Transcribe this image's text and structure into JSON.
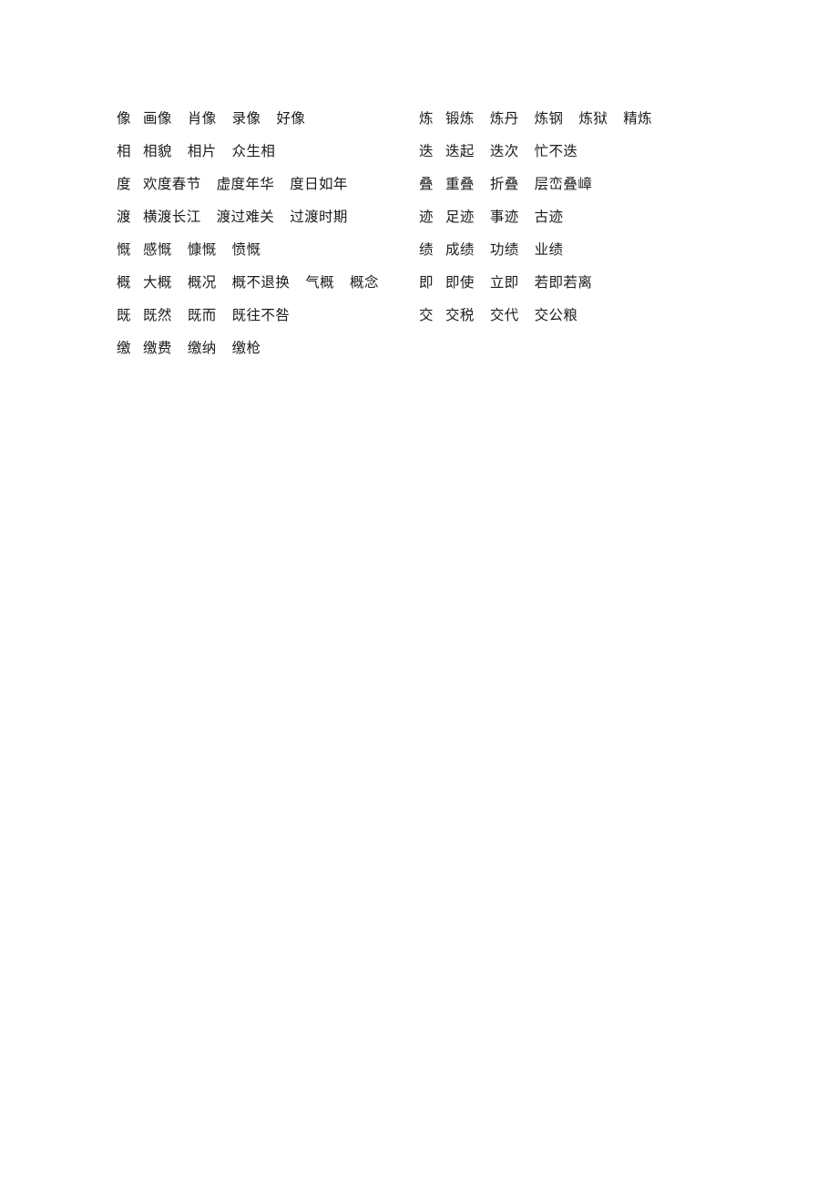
{
  "document": {
    "page_background": "#ffffff",
    "text_color": "#1c1c1c",
    "columns": [
      {
        "id": "left",
        "rows": [
          {
            "headword": "像",
            "terms": [
              "画像",
              "肖像",
              "录像",
              "好像"
            ]
          },
          {
            "headword": "相",
            "terms": [
              "相貌",
              "相片",
              "众生相"
            ]
          },
          {
            "headword": "度",
            "terms": [
              "欢度春节",
              "虚度年华",
              "度日如年"
            ]
          },
          {
            "headword": "渡",
            "terms": [
              "横渡长江",
              "渡过难关",
              "过渡时期"
            ]
          },
          {
            "headword": "慨",
            "terms": [
              "感慨",
              "慷慨",
              "愤慨"
            ]
          },
          {
            "headword": "概",
            "terms": [
              "大概",
              "概况",
              "概不退换",
              "气概",
              "概念"
            ]
          },
          {
            "headword": "既",
            "terms": [
              "既然",
              "既而",
              "既往不咎"
            ]
          },
          {
            "headword": "缴",
            "terms": [
              "缴费",
              "缴纳",
              "缴枪"
            ]
          }
        ]
      },
      {
        "id": "right",
        "rows": [
          {
            "headword": "炼",
            "terms": [
              "锻炼",
              "炼丹",
              "炼钢",
              "炼狱",
              "精炼"
            ]
          },
          {
            "headword": "迭",
            "terms": [
              "迭起",
              "迭次",
              "忙不迭"
            ]
          },
          {
            "headword": "叠",
            "terms": [
              "重叠",
              "折叠",
              "层峦叠嶂"
            ]
          },
          {
            "headword": "迹",
            "terms": [
              "足迹",
              "事迹",
              "古迹"
            ]
          },
          {
            "headword": "绩",
            "terms": [
              "成绩",
              "功绩",
              "业绩"
            ]
          },
          {
            "headword": "即",
            "terms": [
              "即使",
              "立即",
              "若即若离"
            ]
          },
          {
            "headword": "交",
            "terms": [
              "交税",
              "交代",
              "交公粮"
            ]
          }
        ]
      }
    ]
  }
}
